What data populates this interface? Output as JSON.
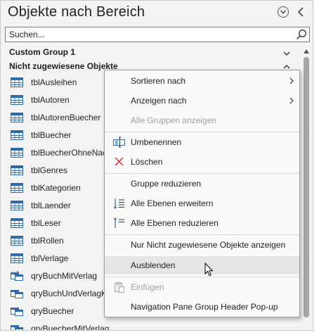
{
  "pane": {
    "title": "Objekte nach Bereich",
    "search_placeholder": "Suchen...",
    "groups": [
      {
        "label": "Custom Group 1",
        "expanded": false
      },
      {
        "label": "Nicht zugewiesene Objekte",
        "expanded": true
      }
    ],
    "items": [
      {
        "label": "tblAusleihen",
        "icon": "table-icon"
      },
      {
        "label": "tblAutoren",
        "icon": "table-icon"
      },
      {
        "label": "tblAutorenBuecher",
        "icon": "table-icon"
      },
      {
        "label": "tblBuecher",
        "icon": "table-icon"
      },
      {
        "label": "tblBuecherOhneNac",
        "icon": "table-icon"
      },
      {
        "label": "tblGenres",
        "icon": "table-icon"
      },
      {
        "label": "tblKategorien",
        "icon": "table-icon"
      },
      {
        "label": "tblLaender",
        "icon": "table-icon"
      },
      {
        "label": "tblLeser",
        "icon": "table-icon"
      },
      {
        "label": "tblRollen",
        "icon": "table-icon"
      },
      {
        "label": "tblVerlage",
        "icon": "table-icon"
      },
      {
        "label": "qryBuchMitVerlag",
        "icon": "query-icon"
      },
      {
        "label": "qryBuchUndVerlagK",
        "icon": "query-icon"
      },
      {
        "label": "qryBuecher",
        "icon": "query-icon"
      },
      {
        "label": "qryBuecherMitVerlag",
        "icon": "query-icon"
      }
    ]
  },
  "context_menu": {
    "items": [
      {
        "label": "Sortieren nach",
        "submenu": true,
        "enabled": true
      },
      {
        "label": "Anzeigen nach",
        "submenu": true,
        "enabled": true
      },
      {
        "label": "Alle Gruppen anzeigen",
        "submenu": false,
        "enabled": false
      },
      {
        "label": "Umbenennen",
        "icon": "rename-icon",
        "enabled": true
      },
      {
        "label": "Löschen",
        "icon": "delete-x-icon",
        "enabled": true
      },
      {
        "label": "Gruppe reduzieren",
        "enabled": true
      },
      {
        "label": "Alle Ebenen erweitern",
        "icon": "expand-all-icon",
        "enabled": true
      },
      {
        "label": "Alle Ebenen reduzieren",
        "icon": "collapse-all-icon",
        "enabled": true
      },
      {
        "label": "Nur Nicht zugewiesene Objekte anzeigen",
        "enabled": true
      },
      {
        "label": "Ausblenden",
        "enabled": true,
        "hovered": true
      },
      {
        "label": "Einfügen",
        "icon": "paste-icon",
        "enabled": false
      },
      {
        "label": "Navigation Pane Group Header Pop-up",
        "enabled": true
      }
    ]
  },
  "colors": {
    "pane_bg": "#f3f3f3",
    "menu_bg": "#f9f9f9",
    "table_icon_blue": "#2b6cb0",
    "delete_red": "#d13438",
    "disabled_text": "#a0a0a0"
  }
}
